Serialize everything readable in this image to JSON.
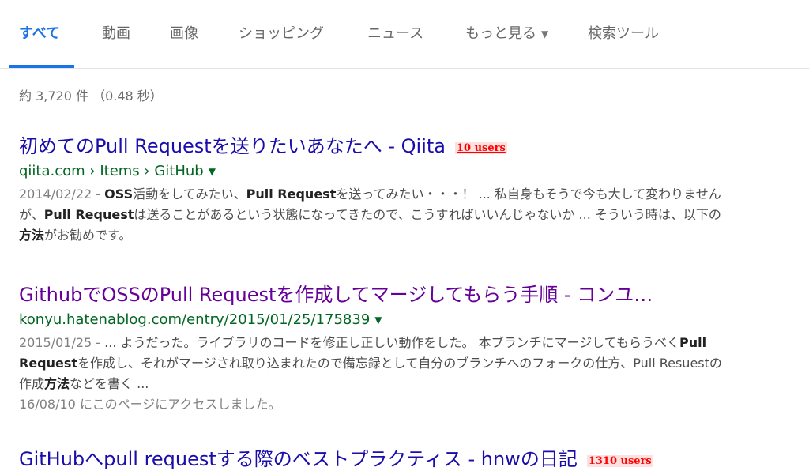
{
  "tabs": [
    {
      "label": "すべて",
      "active": true
    },
    {
      "label": "動画"
    },
    {
      "label": "画像"
    },
    {
      "label": "ショッピング"
    },
    {
      "label": "ニュース"
    },
    {
      "label": "もっと見る"
    },
    {
      "label": "検索ツール"
    }
  ],
  "stats": "約 3,720 件 （0.48 秒）",
  "results": [
    {
      "title": "初めてのPull Requestを送りたいあなたへ - Qiita",
      "badge": "10 users",
      "url": "qiita.com › Items › GitHub",
      "date": "2014/02/22 - ",
      "snippet_parts": [
        {
          "b": "OSS"
        },
        {
          "t": "活動をしてみたい、"
        },
        {
          "b": "Pull Request"
        },
        {
          "t": "を送ってみたい・・・！ ... 私自身もそうで今も大して変わりませんが、"
        },
        {
          "b": "Pull Request"
        },
        {
          "t": "は送ることがあるという状態になってきたので、こうすればいいんじゃないか ... そういう時は、以下の"
        },
        {
          "b": "方法"
        },
        {
          "t": "がお勧めです。"
        }
      ]
    },
    {
      "title": "GithubでOSSのPull Requestを作成してマージしてもらう手順 - コンユ…",
      "url": "konyu.hatenablog.com/entry/2015/01/25/175839",
      "date": "2015/01/25 - ",
      "snippet_parts": [
        {
          "t": "... ようだった。ライブラリのコードを修正し正しい動作をした。 本ブランチにマージしてもらうべく"
        },
        {
          "b": "Pull Request"
        },
        {
          "t": "を作成し、それがマージされ取り込まれたので備忘録として自分のブランチへのフォークの仕方、Pull Resuestの作成"
        },
        {
          "b": "方法"
        },
        {
          "t": "などを書く ..."
        }
      ],
      "visited_note": "16/08/10 にこのページにアクセスしました。"
    },
    {
      "title": "GitHubへpull requestする際のベストプラクティス - hnwの日記",
      "badge": "1310 users"
    }
  ]
}
